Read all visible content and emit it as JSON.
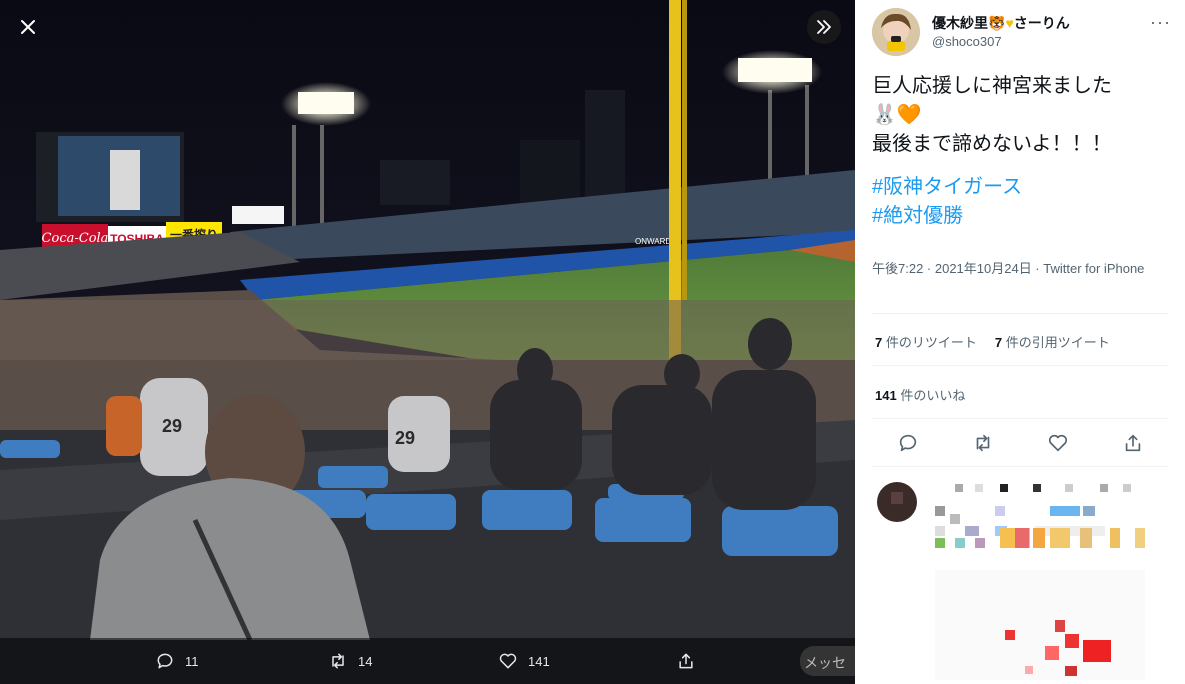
{
  "viewer": {
    "close_icon": "close-icon",
    "expand_icon": "chevron-double-right-icon",
    "actions": {
      "reply_count": "11",
      "retweet_count": "14",
      "like_count": "141"
    },
    "message_peek": "メッセ"
  },
  "photo": {
    "scoreboard_ads": [
      "Coca-Cola",
      "TOSHIBA",
      "一番搾り"
    ],
    "jersey_number": "29",
    "outfield_ad": "ONWARD"
  },
  "tweet": {
    "display_name": "優木紗里",
    "display_name_suffix": "さーりん",
    "handle": "@shoco307",
    "lines": [
      "巨人応援しに神宮来ました",
      "最後まで諦めないよ！！！"
    ],
    "emoji_line": "🐰🧡",
    "hashtags": [
      "#阪神タイガース",
      "#絶対優勝"
    ],
    "meta": "午後7:22 · 2021年10月24日 · Twitter for iPhone",
    "retweets": "7",
    "retweets_label": "件のリツイート",
    "quotes": "7",
    "quotes_label": "件の引用ツイート",
    "likes": "141",
    "likes_label": "件のいいね"
  },
  "colors": {
    "accent": "#1d9bf0",
    "text": "#0f1419",
    "muted": "#536471"
  }
}
